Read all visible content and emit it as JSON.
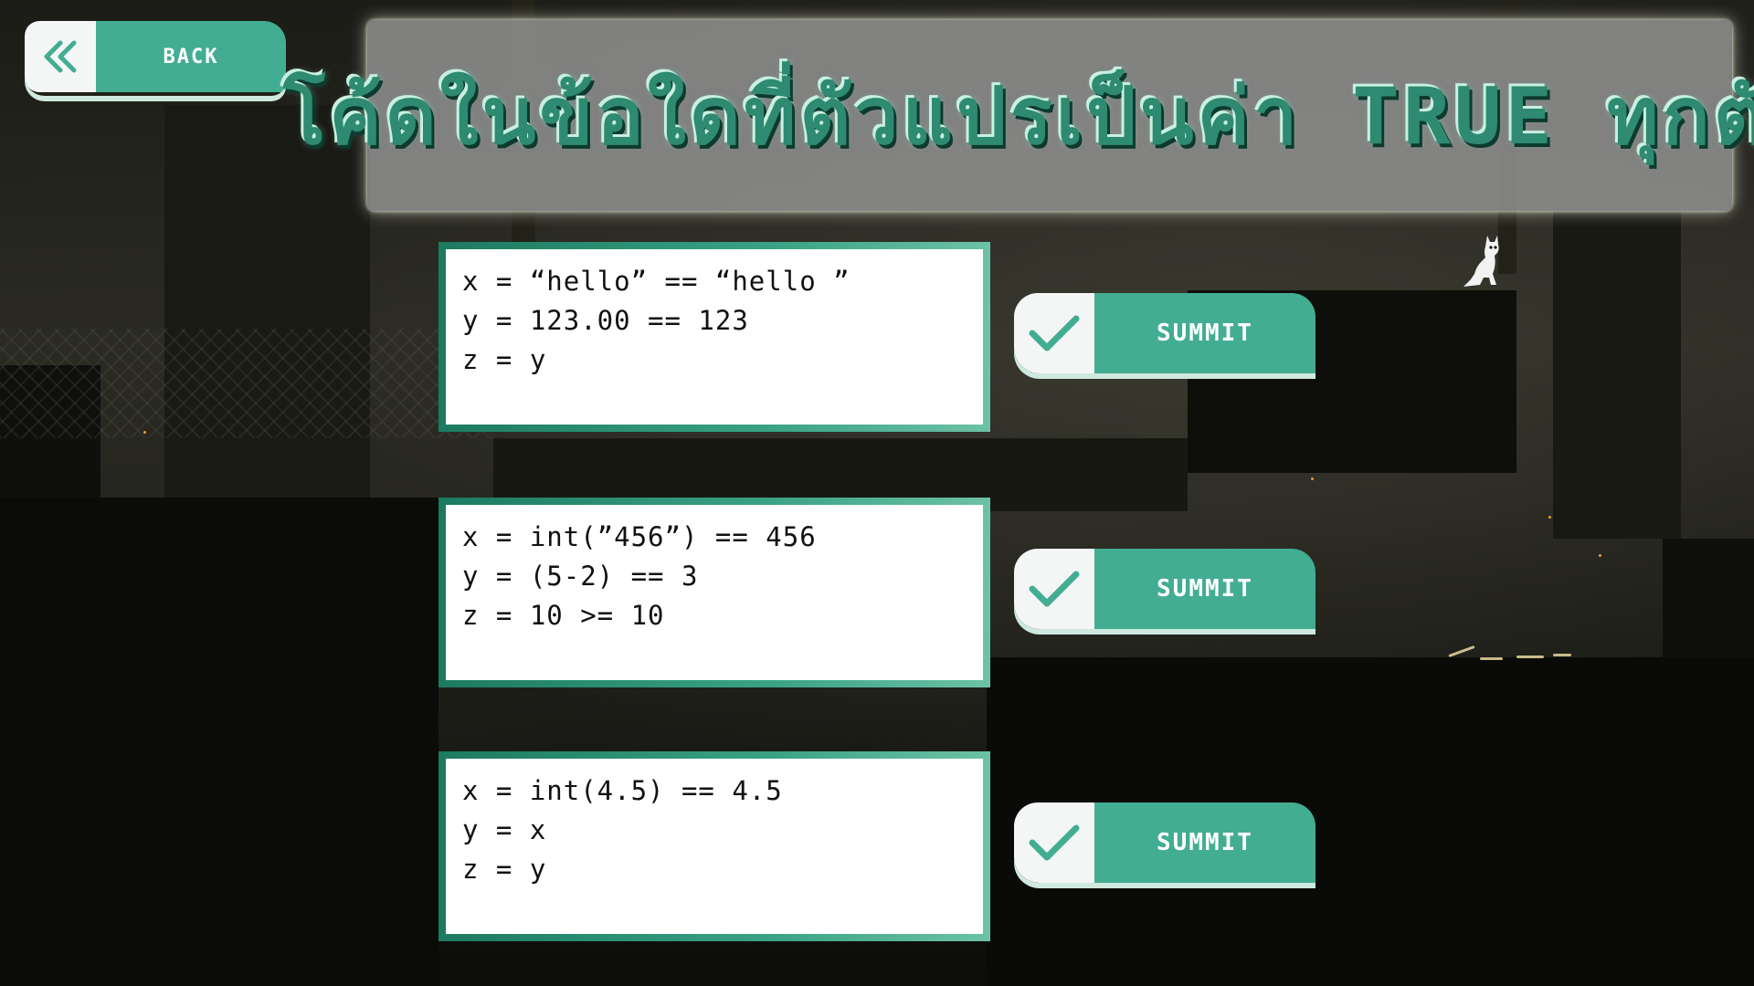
{
  "back_button": {
    "label": "BACK",
    "icon": "double-chevron-left-icon"
  },
  "title": "โค้ดในข้อใดที่ตัวแปรเป็นค่า TRUE ทุกตัว",
  "questions": [
    {
      "code": [
        "x = “hello” == “hello ”",
        "y = 123.00 == 123",
        "z = y"
      ],
      "submit_label": "SUMMIT",
      "submit_icon": "checkmark-icon"
    },
    {
      "code": [
        "x = int(”456”) == 456",
        "y = (5-2) == 3",
        "z = 10 >= 10"
      ],
      "submit_label": "SUMMIT",
      "submit_icon": "checkmark-icon"
    },
    {
      "code": [
        "x = int(4.5) == 4.5",
        "y = x",
        "z = y"
      ],
      "submit_label": "SUMMIT",
      "submit_icon": "checkmark-icon"
    }
  ],
  "colors": {
    "accent": "#43ad92",
    "title_text": "#2e8a70",
    "banner": "#969696",
    "card_border": "#1c7a5f"
  }
}
